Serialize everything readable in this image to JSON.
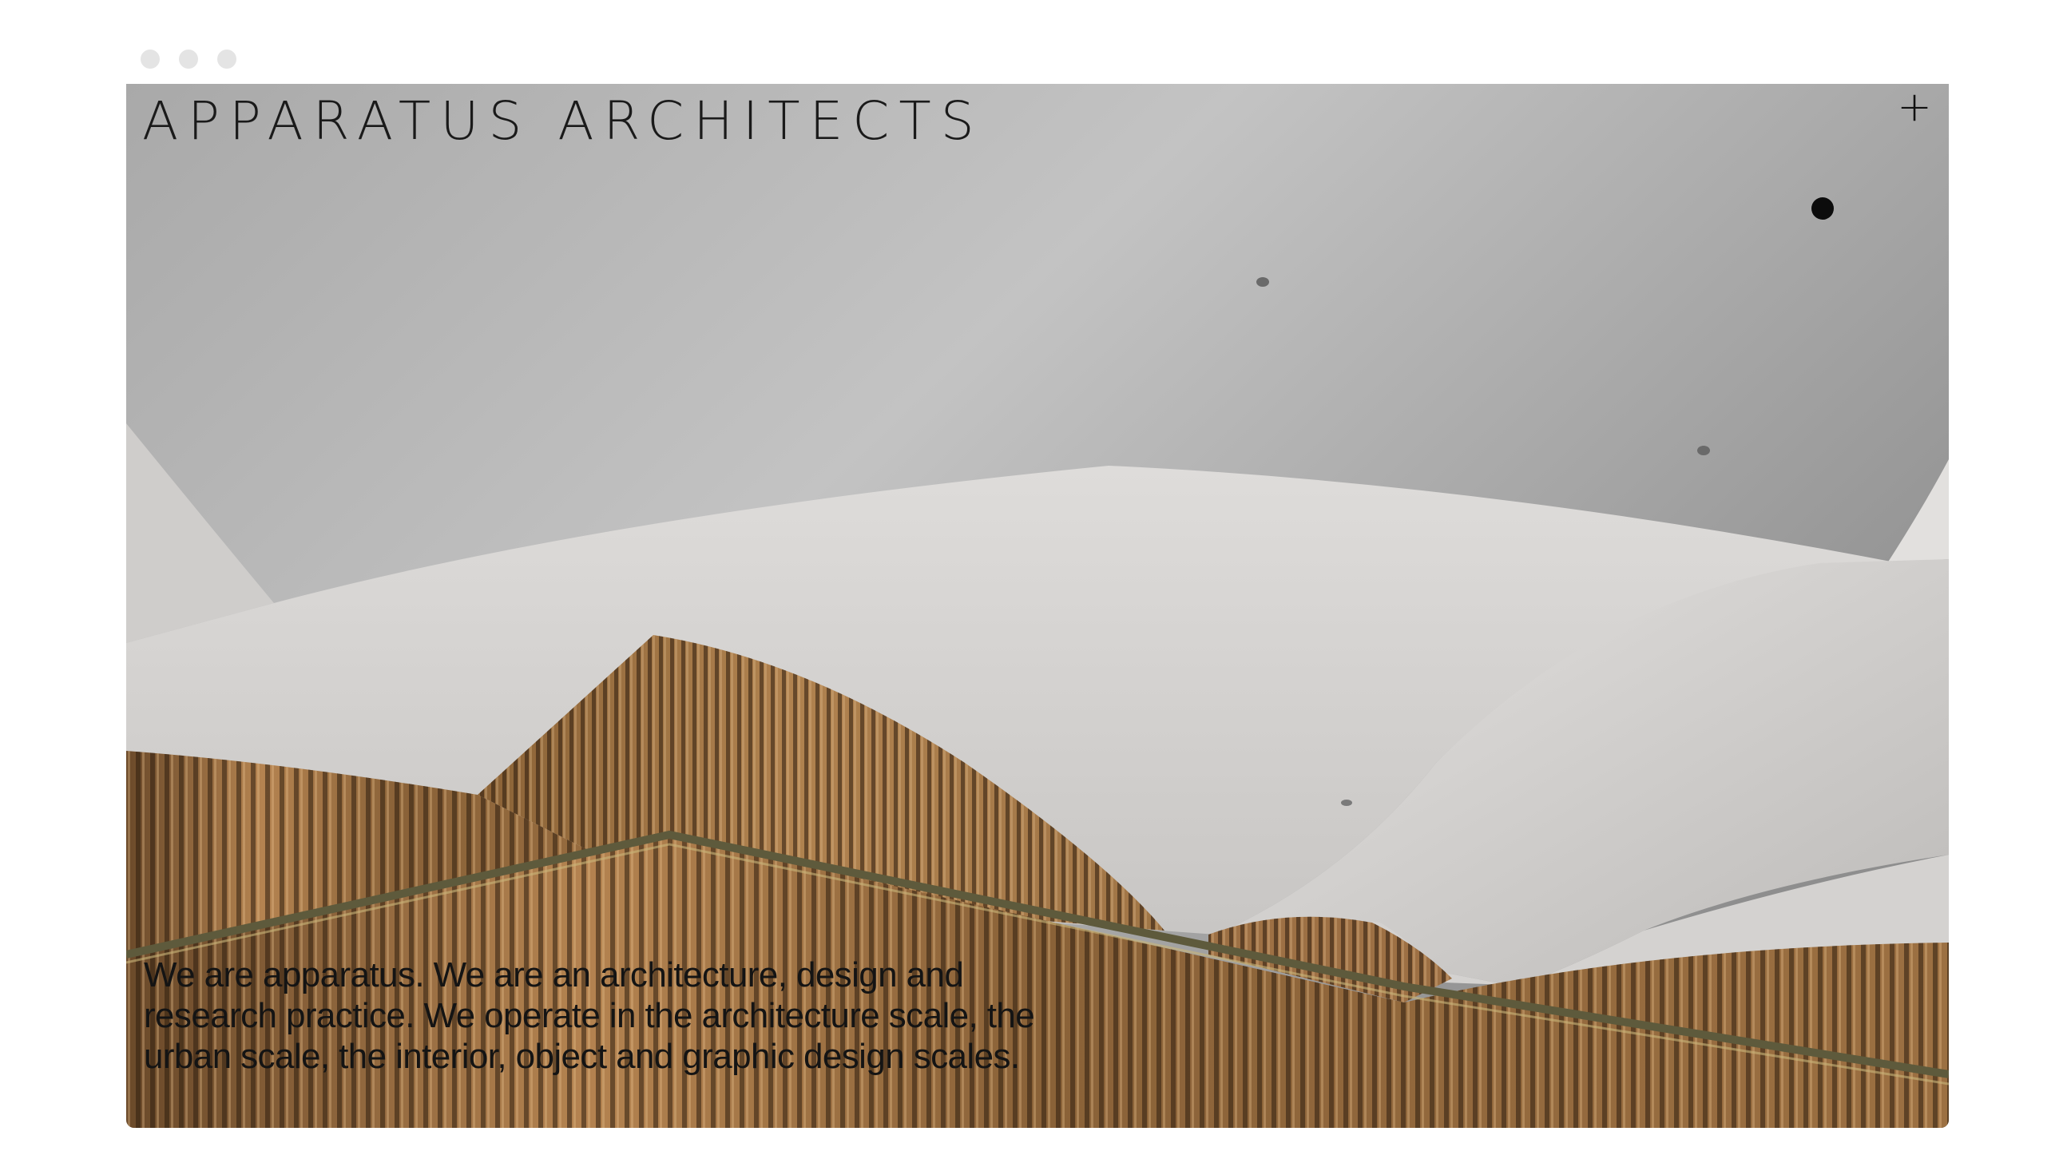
{
  "window": {
    "controls": [
      "close-dot",
      "minimize-dot",
      "maximize-dot"
    ]
  },
  "header": {
    "site_title": "APPARATUS ARCHITECTS",
    "menu_icon": "plus-icon",
    "menu_symbol": "+"
  },
  "hero": {
    "intro_text": "We are apparatus. We are an architecture, design and research practice. We operate in the architecture scale, the urban scale, the interior, object and graphic design scales."
  },
  "colors": {
    "page_background": "#ffffff",
    "window_dot": "#e4e4e4",
    "text": "#141414",
    "ceiling": "#b8b8b8",
    "wood": "#9a6b3a"
  }
}
